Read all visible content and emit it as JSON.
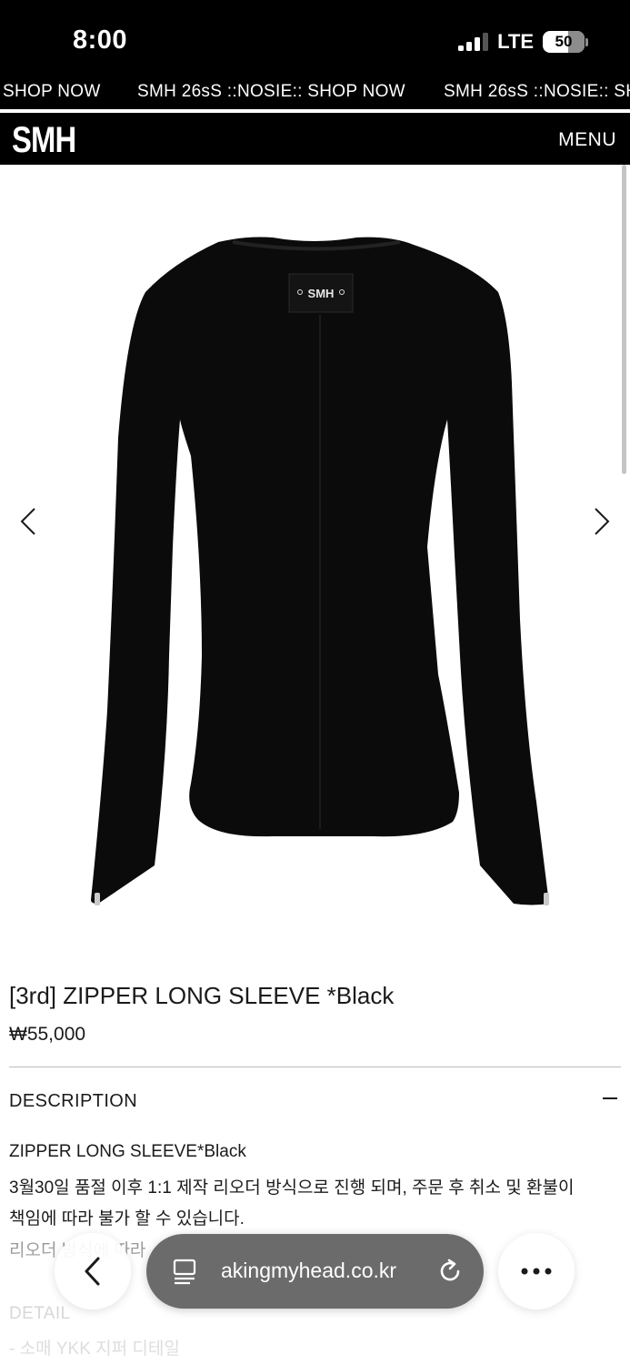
{
  "status_bar": {
    "time": "8:00",
    "network": "LTE",
    "battery": "50",
    "signal_bars": 4,
    "signal_active": 3
  },
  "marquee": {
    "items": [
      "SHOP NOW",
      "SMH 26sS ::NOSIE:: SHOP NOW",
      "SMH 26sS ::NOSIE:: SH"
    ]
  },
  "header": {
    "logo": "SMH",
    "menu_label": "MENU"
  },
  "product": {
    "image_label": "SMH",
    "title": "[3rd] ZIPPER LONG SLEEVE *Black",
    "price": "₩55,000"
  },
  "description": {
    "header": "DESCRIPTION",
    "lines": [
      "ZIPPER LONG SLEEVE*Black",
      "3월30일 품절 이후 1:1 제작 리오더 방식으로 진행 되며, 주문 후 취소 및 환불이",
      "책임에 따라 불가 할 수 있습니다.",
      "리오더 방식에 따라"
    ]
  },
  "detail": {
    "header": "DETAIL",
    "lines": [
      "- 소매 YKK 지퍼 디테일"
    ]
  },
  "browser": {
    "url": "akingmyhead.co.kr"
  },
  "icons": {
    "prev": "chevron-left-icon",
    "next": "chevron-right-icon",
    "back": "back-arrow-icon",
    "reader": "reader-mode-icon",
    "reload": "reload-icon",
    "more": "more-dots-icon"
  },
  "colors": {
    "header_bg": "#000000",
    "header_text": "#ffffff",
    "url_pill": "#6b6b6b"
  }
}
